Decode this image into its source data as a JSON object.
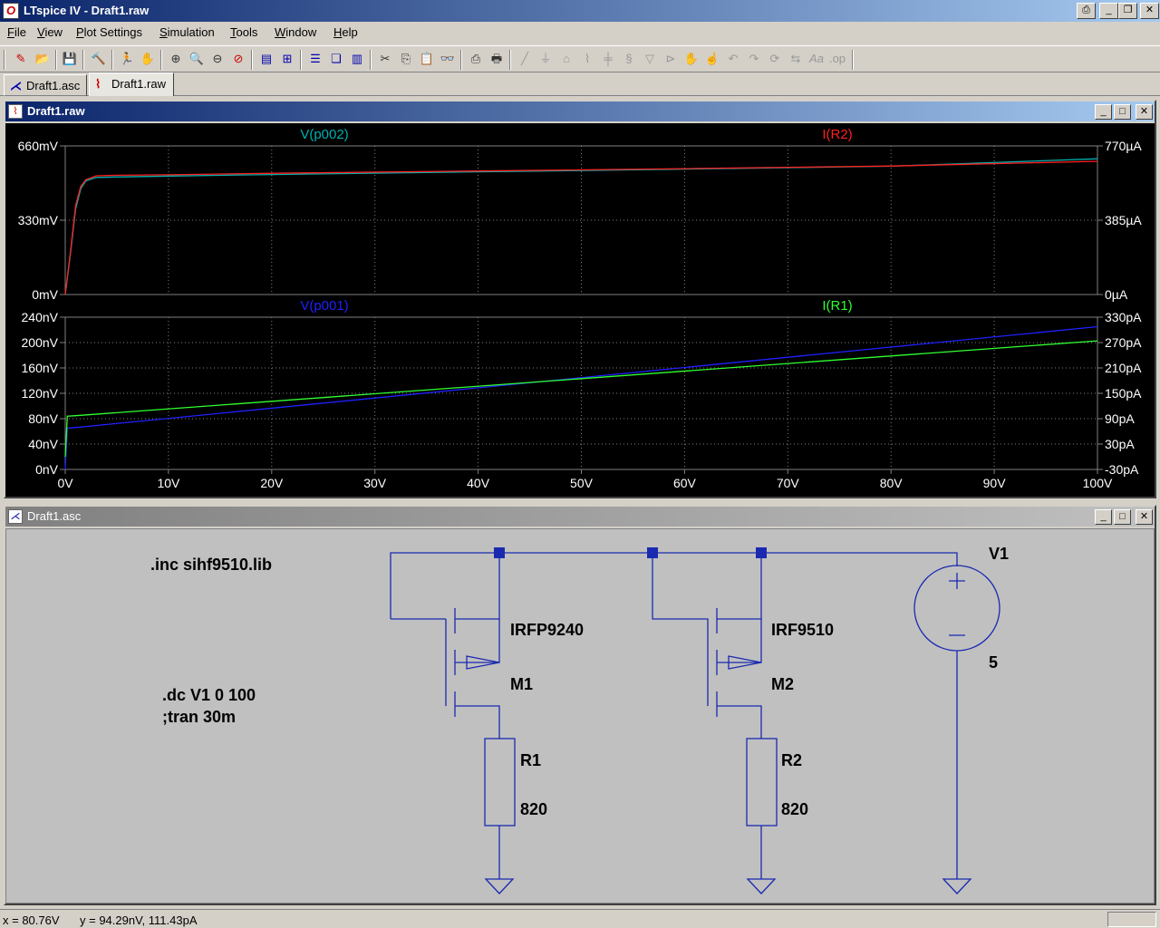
{
  "window": {
    "title": "LTspice IV - Draft1.raw",
    "icon": "ltspice-logo-icon",
    "buttons": [
      "print-icon",
      "minimize-icon",
      "restore-icon",
      "close-icon"
    ]
  },
  "menu": [
    "File",
    "View",
    "Plot Settings",
    "Simulation",
    "Tools",
    "Window",
    "Help"
  ],
  "toolbar": {
    "icons": [
      "new-schematic-icon",
      "open-icon",
      "save-icon",
      "control-panel-icon",
      "run-icon",
      "halt-icon",
      "zoom-in-icon",
      "zoom-full-icon",
      "zoom-out-icon",
      "zoom-cancel-icon",
      "autoscale-icon",
      "plot-settings-icon",
      "tile-horizontal-icon",
      "cascade-icon",
      "tile-vertical-icon",
      "cut-icon",
      "copy-icon",
      "paste-icon",
      "find-icon",
      "print-preview-icon",
      "print-icon",
      "wire-icon",
      "ground-icon",
      "label-icon",
      "resistor-icon",
      "capacitor-icon",
      "inductor-icon",
      "diode-icon",
      "component-icon",
      "move-icon",
      "drag-icon",
      "undo-icon",
      "redo-icon",
      "rotate-icon",
      "mirror-icon",
      "text-icon",
      "spice-directive-icon"
    ]
  },
  "tabs": [
    {
      "label": "Draft1.asc",
      "icon": "schematic-icon",
      "active": false
    },
    {
      "label": "Draft1.raw",
      "icon": "waveform-icon",
      "active": true
    }
  ],
  "plot_window": {
    "title": "Draft1.raw",
    "icon": "waveform-icon"
  },
  "schematic_window": {
    "title": "Draft1.asc",
    "icon": "schematic-icon"
  },
  "chart_data": [
    {
      "type": "line",
      "background": "#000000",
      "x_ticks": [
        "0V",
        "10V",
        "20V",
        "30V",
        "40V",
        "50V",
        "60V",
        "70V",
        "80V",
        "90V",
        "100V"
      ],
      "xlim": [
        0,
        100
      ],
      "y_left_ticks": [
        "660mV",
        "330mV",
        "0mV"
      ],
      "y_right_ticks": [
        "770µA",
        "385µA",
        "0µA"
      ],
      "ylim_left": [
        0,
        660
      ],
      "ylim_right": [
        0,
        770
      ],
      "grid": true,
      "series": [
        {
          "name": "V(p002)",
          "color": "#00b0b0",
          "axis": "left",
          "x": [
            0,
            0.5,
            1,
            1.5,
            2,
            3,
            5,
            10,
            20,
            40,
            60,
            80,
            100
          ],
          "y": [
            0,
            180,
            380,
            470,
            505,
            520,
            522,
            526,
            533,
            545,
            557,
            570,
            603
          ]
        },
        {
          "name": "I(R2)",
          "color": "#ff2020",
          "axis": "right",
          "x": [
            0,
            0.5,
            1,
            1.5,
            2,
            3,
            5,
            10,
            20,
            40,
            60,
            80,
            100
          ],
          "y": [
            0,
            220,
            460,
            560,
            595,
            615,
            618,
            620,
            628,
            640,
            652,
            666,
            690
          ]
        }
      ]
    },
    {
      "type": "line",
      "background": "#000000",
      "x_ticks": [
        "0V",
        "10V",
        "20V",
        "30V",
        "40V",
        "50V",
        "60V",
        "70V",
        "80V",
        "90V",
        "100V"
      ],
      "xlim": [
        0,
        100
      ],
      "y_left_ticks": [
        "240nV",
        "200nV",
        "160nV",
        "120nV",
        "80nV",
        "40nV",
        "0nV"
      ],
      "y_right_ticks": [
        "330pA",
        "270pA",
        "210pA",
        "150pA",
        "90pA",
        "30pA",
        "-30pA"
      ],
      "ylim_left": [
        0,
        240
      ],
      "ylim_right": [
        -30,
        330
      ],
      "grid": true,
      "series": [
        {
          "name": "V(p001)",
          "color": "#2020ff",
          "axis": "left",
          "x": [
            0,
            0.2,
            1,
            100
          ],
          "y": [
            0,
            65,
            66,
            225
          ]
        },
        {
          "name": "I(R1)",
          "color": "#30ff30",
          "axis": "right",
          "x": [
            0,
            0.2,
            1,
            100
          ],
          "y": [
            0,
            96,
            97,
            274
          ]
        }
      ]
    }
  ],
  "schematic": {
    "directives": [
      ".inc sihf9510.lib",
      ".dc V1 0 100",
      ";tran 30m"
    ],
    "components": [
      {
        "ref": "M1",
        "value": "IRFP9240"
      },
      {
        "ref": "M2",
        "value": "IRF9510"
      },
      {
        "ref": "R1",
        "value": "820"
      },
      {
        "ref": "R2",
        "value": "820"
      },
      {
        "ref": "V1",
        "value": "5"
      }
    ]
  },
  "status": {
    "x": "x = 80.76V",
    "y": "y = 94.29nV, 111.43pA"
  }
}
